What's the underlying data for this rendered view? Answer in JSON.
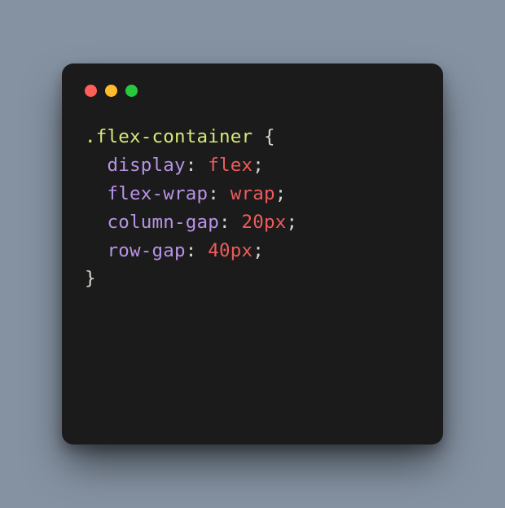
{
  "code": {
    "selector": ".flex-container",
    "open_brace": " {",
    "close_brace": "}",
    "colon": ":",
    "semicolon": ";",
    "declarations": [
      {
        "prop": "display",
        "value": "flex"
      },
      {
        "prop": "flex-wrap",
        "value": "wrap"
      },
      {
        "prop": "column-gap",
        "value": "20px"
      },
      {
        "prop": "row-gap",
        "value": "40px"
      }
    ]
  },
  "traffic_lights": [
    "close",
    "minimize",
    "zoom"
  ]
}
